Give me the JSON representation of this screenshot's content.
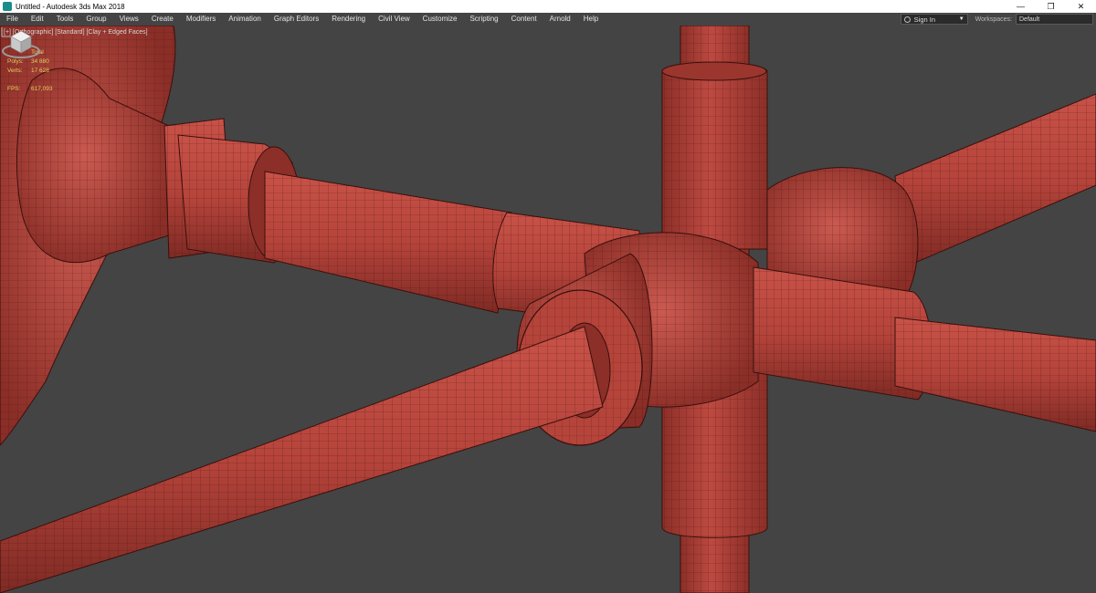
{
  "titlebar": {
    "title": "Untitled - Autodesk 3ds Max 2018",
    "minimize": "—",
    "restore": "❐",
    "close": "✕"
  },
  "menu": {
    "items": [
      "File",
      "Edit",
      "Tools",
      "Group",
      "Views",
      "Create",
      "Modifiers",
      "Animation",
      "Graph Editors",
      "Rendering",
      "Civil View",
      "Customize",
      "Scripting",
      "Content",
      "Arnold",
      "Help"
    ],
    "signin": "Sign In",
    "workspaces_label": "Workspaces:",
    "workspace_value": "Default"
  },
  "viewport": {
    "label": "[+] [Orthographic] [Standard] [Clay + Edged Faces]",
    "stats": {
      "header": "Total",
      "polys_label": "Polys:",
      "polys_value": "34 880",
      "verts_label": "Verts:",
      "verts_value": "17 628",
      "fps_label": "FPS:",
      "fps_value": "617,093"
    }
  },
  "colors": {
    "clay": "#b5443b",
    "clay_dark": "#8c2f28",
    "wire": "#3a0f0c",
    "viewport_bg": "#444444",
    "stats_text": "#e8d060"
  },
  "icons": {
    "app": "3dsmax-app-icon",
    "viewcube": "viewcube-icon",
    "user": "user-icon"
  }
}
